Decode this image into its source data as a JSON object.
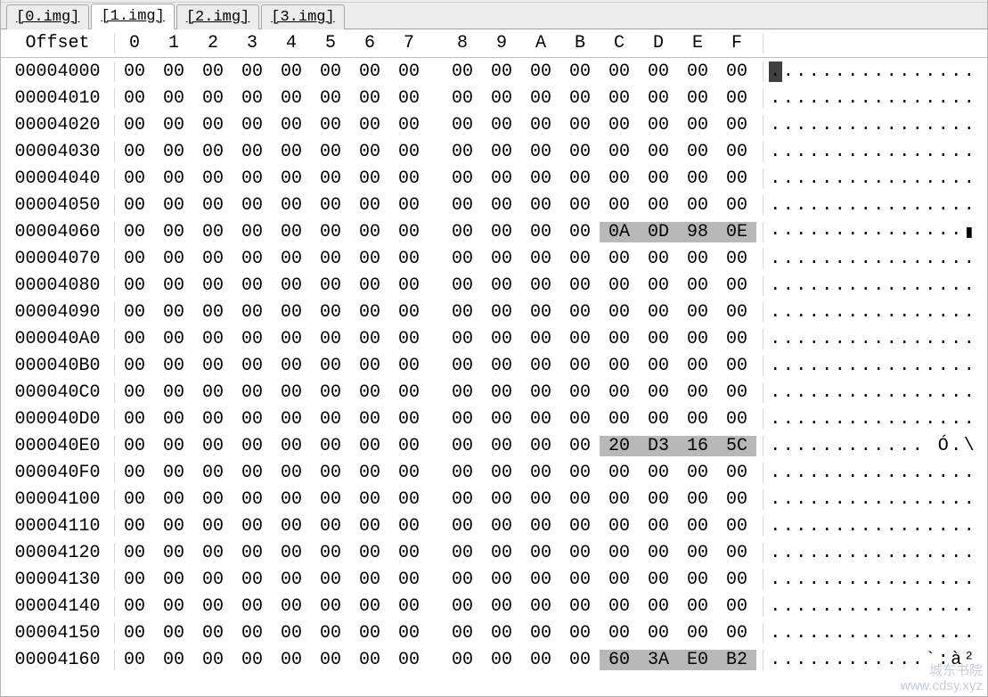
{
  "tabs": [
    {
      "label": "[0.img]",
      "active": false
    },
    {
      "label": "[1.img]",
      "active": true
    },
    {
      "label": "[2.img]",
      "active": false
    },
    {
      "label": "[3.img]",
      "active": false
    }
  ],
  "header": {
    "offset_label": "Offset",
    "cols": [
      "0",
      "1",
      "2",
      "3",
      "4",
      "5",
      "6",
      "7",
      "8",
      "9",
      "A",
      "B",
      "C",
      "D",
      "E",
      "F"
    ]
  },
  "rows": [
    {
      "offset": "00004000",
      "hex": [
        "00",
        "00",
        "00",
        "00",
        "00",
        "00",
        "00",
        "00",
        "00",
        "00",
        "00",
        "00",
        "00",
        "00",
        "00",
        "00"
      ],
      "ascii": "................",
      "hl": [],
      "cursor": 0
    },
    {
      "offset": "00004010",
      "hex": [
        "00",
        "00",
        "00",
        "00",
        "00",
        "00",
        "00",
        "00",
        "00",
        "00",
        "00",
        "00",
        "00",
        "00",
        "00",
        "00"
      ],
      "ascii": "................",
      "hl": []
    },
    {
      "offset": "00004020",
      "hex": [
        "00",
        "00",
        "00",
        "00",
        "00",
        "00",
        "00",
        "00",
        "00",
        "00",
        "00",
        "00",
        "00",
        "00",
        "00",
        "00"
      ],
      "ascii": "................",
      "hl": []
    },
    {
      "offset": "00004030",
      "hex": [
        "00",
        "00",
        "00",
        "00",
        "00",
        "00",
        "00",
        "00",
        "00",
        "00",
        "00",
        "00",
        "00",
        "00",
        "00",
        "00"
      ],
      "ascii": "................",
      "hl": []
    },
    {
      "offset": "00004040",
      "hex": [
        "00",
        "00",
        "00",
        "00",
        "00",
        "00",
        "00",
        "00",
        "00",
        "00",
        "00",
        "00",
        "00",
        "00",
        "00",
        "00"
      ],
      "ascii": "................",
      "hl": []
    },
    {
      "offset": "00004050",
      "hex": [
        "00",
        "00",
        "00",
        "00",
        "00",
        "00",
        "00",
        "00",
        "00",
        "00",
        "00",
        "00",
        "00",
        "00",
        "00",
        "00"
      ],
      "ascii": "................",
      "hl": []
    },
    {
      "offset": "00004060",
      "hex": [
        "00",
        "00",
        "00",
        "00",
        "00",
        "00",
        "00",
        "00",
        "00",
        "00",
        "00",
        "00",
        "0A",
        "0D",
        "98",
        "0E"
      ],
      "ascii": "...............▮",
      "hl": [
        12,
        13,
        14,
        15
      ]
    },
    {
      "offset": "00004070",
      "hex": [
        "00",
        "00",
        "00",
        "00",
        "00",
        "00",
        "00",
        "00",
        "00",
        "00",
        "00",
        "00",
        "00",
        "00",
        "00",
        "00"
      ],
      "ascii": "................",
      "hl": []
    },
    {
      "offset": "00004080",
      "hex": [
        "00",
        "00",
        "00",
        "00",
        "00",
        "00",
        "00",
        "00",
        "00",
        "00",
        "00",
        "00",
        "00",
        "00",
        "00",
        "00"
      ],
      "ascii": "................",
      "hl": []
    },
    {
      "offset": "00004090",
      "hex": [
        "00",
        "00",
        "00",
        "00",
        "00",
        "00",
        "00",
        "00",
        "00",
        "00",
        "00",
        "00",
        "00",
        "00",
        "00",
        "00"
      ],
      "ascii": "................",
      "hl": []
    },
    {
      "offset": "000040A0",
      "hex": [
        "00",
        "00",
        "00",
        "00",
        "00",
        "00",
        "00",
        "00",
        "00",
        "00",
        "00",
        "00",
        "00",
        "00",
        "00",
        "00"
      ],
      "ascii": "................",
      "hl": []
    },
    {
      "offset": "000040B0",
      "hex": [
        "00",
        "00",
        "00",
        "00",
        "00",
        "00",
        "00",
        "00",
        "00",
        "00",
        "00",
        "00",
        "00",
        "00",
        "00",
        "00"
      ],
      "ascii": "................",
      "hl": []
    },
    {
      "offset": "000040C0",
      "hex": [
        "00",
        "00",
        "00",
        "00",
        "00",
        "00",
        "00",
        "00",
        "00",
        "00",
        "00",
        "00",
        "00",
        "00",
        "00",
        "00"
      ],
      "ascii": "................",
      "hl": []
    },
    {
      "offset": "000040D0",
      "hex": [
        "00",
        "00",
        "00",
        "00",
        "00",
        "00",
        "00",
        "00",
        "00",
        "00",
        "00",
        "00",
        "00",
        "00",
        "00",
        "00"
      ],
      "ascii": "................",
      "hl": []
    },
    {
      "offset": "000040E0",
      "hex": [
        "00",
        "00",
        "00",
        "00",
        "00",
        "00",
        "00",
        "00",
        "00",
        "00",
        "00",
        "00",
        "20",
        "D3",
        "16",
        "5C"
      ],
      "ascii": "............ Ó.\\",
      "hl": [
        12,
        13,
        14,
        15
      ]
    },
    {
      "offset": "000040F0",
      "hex": [
        "00",
        "00",
        "00",
        "00",
        "00",
        "00",
        "00",
        "00",
        "00",
        "00",
        "00",
        "00",
        "00",
        "00",
        "00",
        "00"
      ],
      "ascii": "................",
      "hl": []
    },
    {
      "offset": "00004100",
      "hex": [
        "00",
        "00",
        "00",
        "00",
        "00",
        "00",
        "00",
        "00",
        "00",
        "00",
        "00",
        "00",
        "00",
        "00",
        "00",
        "00"
      ],
      "ascii": "................",
      "hl": []
    },
    {
      "offset": "00004110",
      "hex": [
        "00",
        "00",
        "00",
        "00",
        "00",
        "00",
        "00",
        "00",
        "00",
        "00",
        "00",
        "00",
        "00",
        "00",
        "00",
        "00"
      ],
      "ascii": "................",
      "hl": []
    },
    {
      "offset": "00004120",
      "hex": [
        "00",
        "00",
        "00",
        "00",
        "00",
        "00",
        "00",
        "00",
        "00",
        "00",
        "00",
        "00",
        "00",
        "00",
        "00",
        "00"
      ],
      "ascii": "................",
      "hl": []
    },
    {
      "offset": "00004130",
      "hex": [
        "00",
        "00",
        "00",
        "00",
        "00",
        "00",
        "00",
        "00",
        "00",
        "00",
        "00",
        "00",
        "00",
        "00",
        "00",
        "00"
      ],
      "ascii": "................",
      "hl": []
    },
    {
      "offset": "00004140",
      "hex": [
        "00",
        "00",
        "00",
        "00",
        "00",
        "00",
        "00",
        "00",
        "00",
        "00",
        "00",
        "00",
        "00",
        "00",
        "00",
        "00"
      ],
      "ascii": "................",
      "hl": []
    },
    {
      "offset": "00004150",
      "hex": [
        "00",
        "00",
        "00",
        "00",
        "00",
        "00",
        "00",
        "00",
        "00",
        "00",
        "00",
        "00",
        "00",
        "00",
        "00",
        "00"
      ],
      "ascii": "................",
      "hl": []
    },
    {
      "offset": "00004160",
      "hex": [
        "00",
        "00",
        "00",
        "00",
        "00",
        "00",
        "00",
        "00",
        "00",
        "00",
        "00",
        "00",
        "60",
        "3A",
        "E0",
        "B2"
      ],
      "ascii": "............`:à²",
      "hl": [
        12,
        13,
        14,
        15
      ]
    }
  ],
  "watermark": {
    "line1": "城东书院",
    "line2": "www.cdsy.xyz"
  }
}
